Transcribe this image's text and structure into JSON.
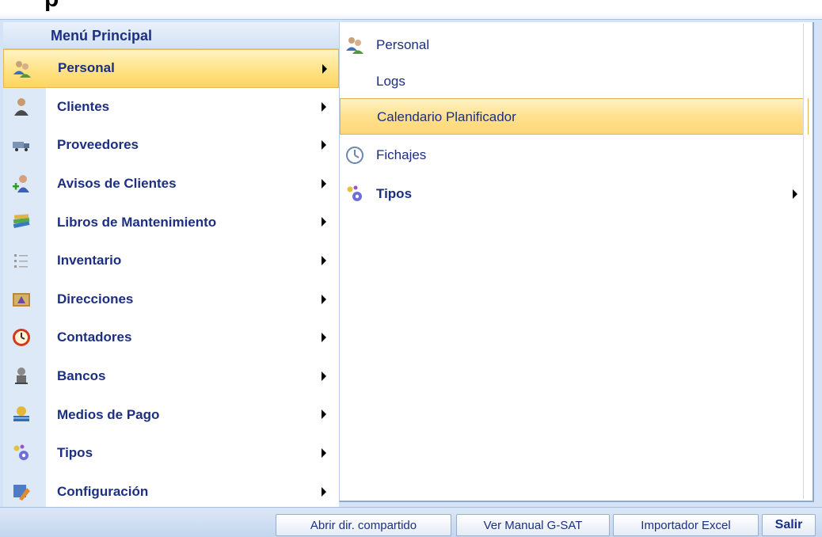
{
  "window": {
    "title_fragment": "p"
  },
  "menu": {
    "header": "Menú Principal",
    "items": [
      {
        "label": "Personal",
        "icon": "people-icon",
        "active": true
      },
      {
        "label": "Clientes",
        "icon": "client-icon"
      },
      {
        "label": "Proveedores",
        "icon": "truck-icon"
      },
      {
        "label": "Avisos de Clientes",
        "icon": "add-user-icon"
      },
      {
        "label": "Libros de Mantenimiento",
        "icon": "books-icon"
      },
      {
        "label": "Inventario",
        "icon": "list-icon"
      },
      {
        "label": "Direcciones",
        "icon": "directory-icon"
      },
      {
        "label": "Contadores",
        "icon": "clock-icon"
      },
      {
        "label": "Bancos",
        "icon": "bank-icon"
      },
      {
        "label": "Medios de Pago",
        "icon": "payment-icon"
      },
      {
        "label": "Tipos",
        "icon": "gears-icon"
      },
      {
        "label": "Configuración",
        "icon": "config-icon"
      }
    ]
  },
  "submenu": {
    "items": [
      {
        "label": "Personal",
        "icon": "people-icon"
      },
      {
        "label": "Logs",
        "icon": ""
      },
      {
        "label": "Calendario Planificador",
        "icon": "",
        "highlighted": true
      },
      {
        "label": "Fichajes",
        "icon": "clock-icon"
      },
      {
        "label": "Tipos",
        "icon": "gears-icon",
        "has_submenu": true
      }
    ]
  },
  "bottom_buttons": {
    "shared_dir": "Abrir dir. compartido",
    "manual": "Ver Manual G-SAT",
    "importer": "Importador Excel",
    "exit": "Salir"
  },
  "colors": {
    "text_blue": "#1c2f80",
    "highlight": "#ffd562",
    "frame": "#c9dcf2"
  }
}
